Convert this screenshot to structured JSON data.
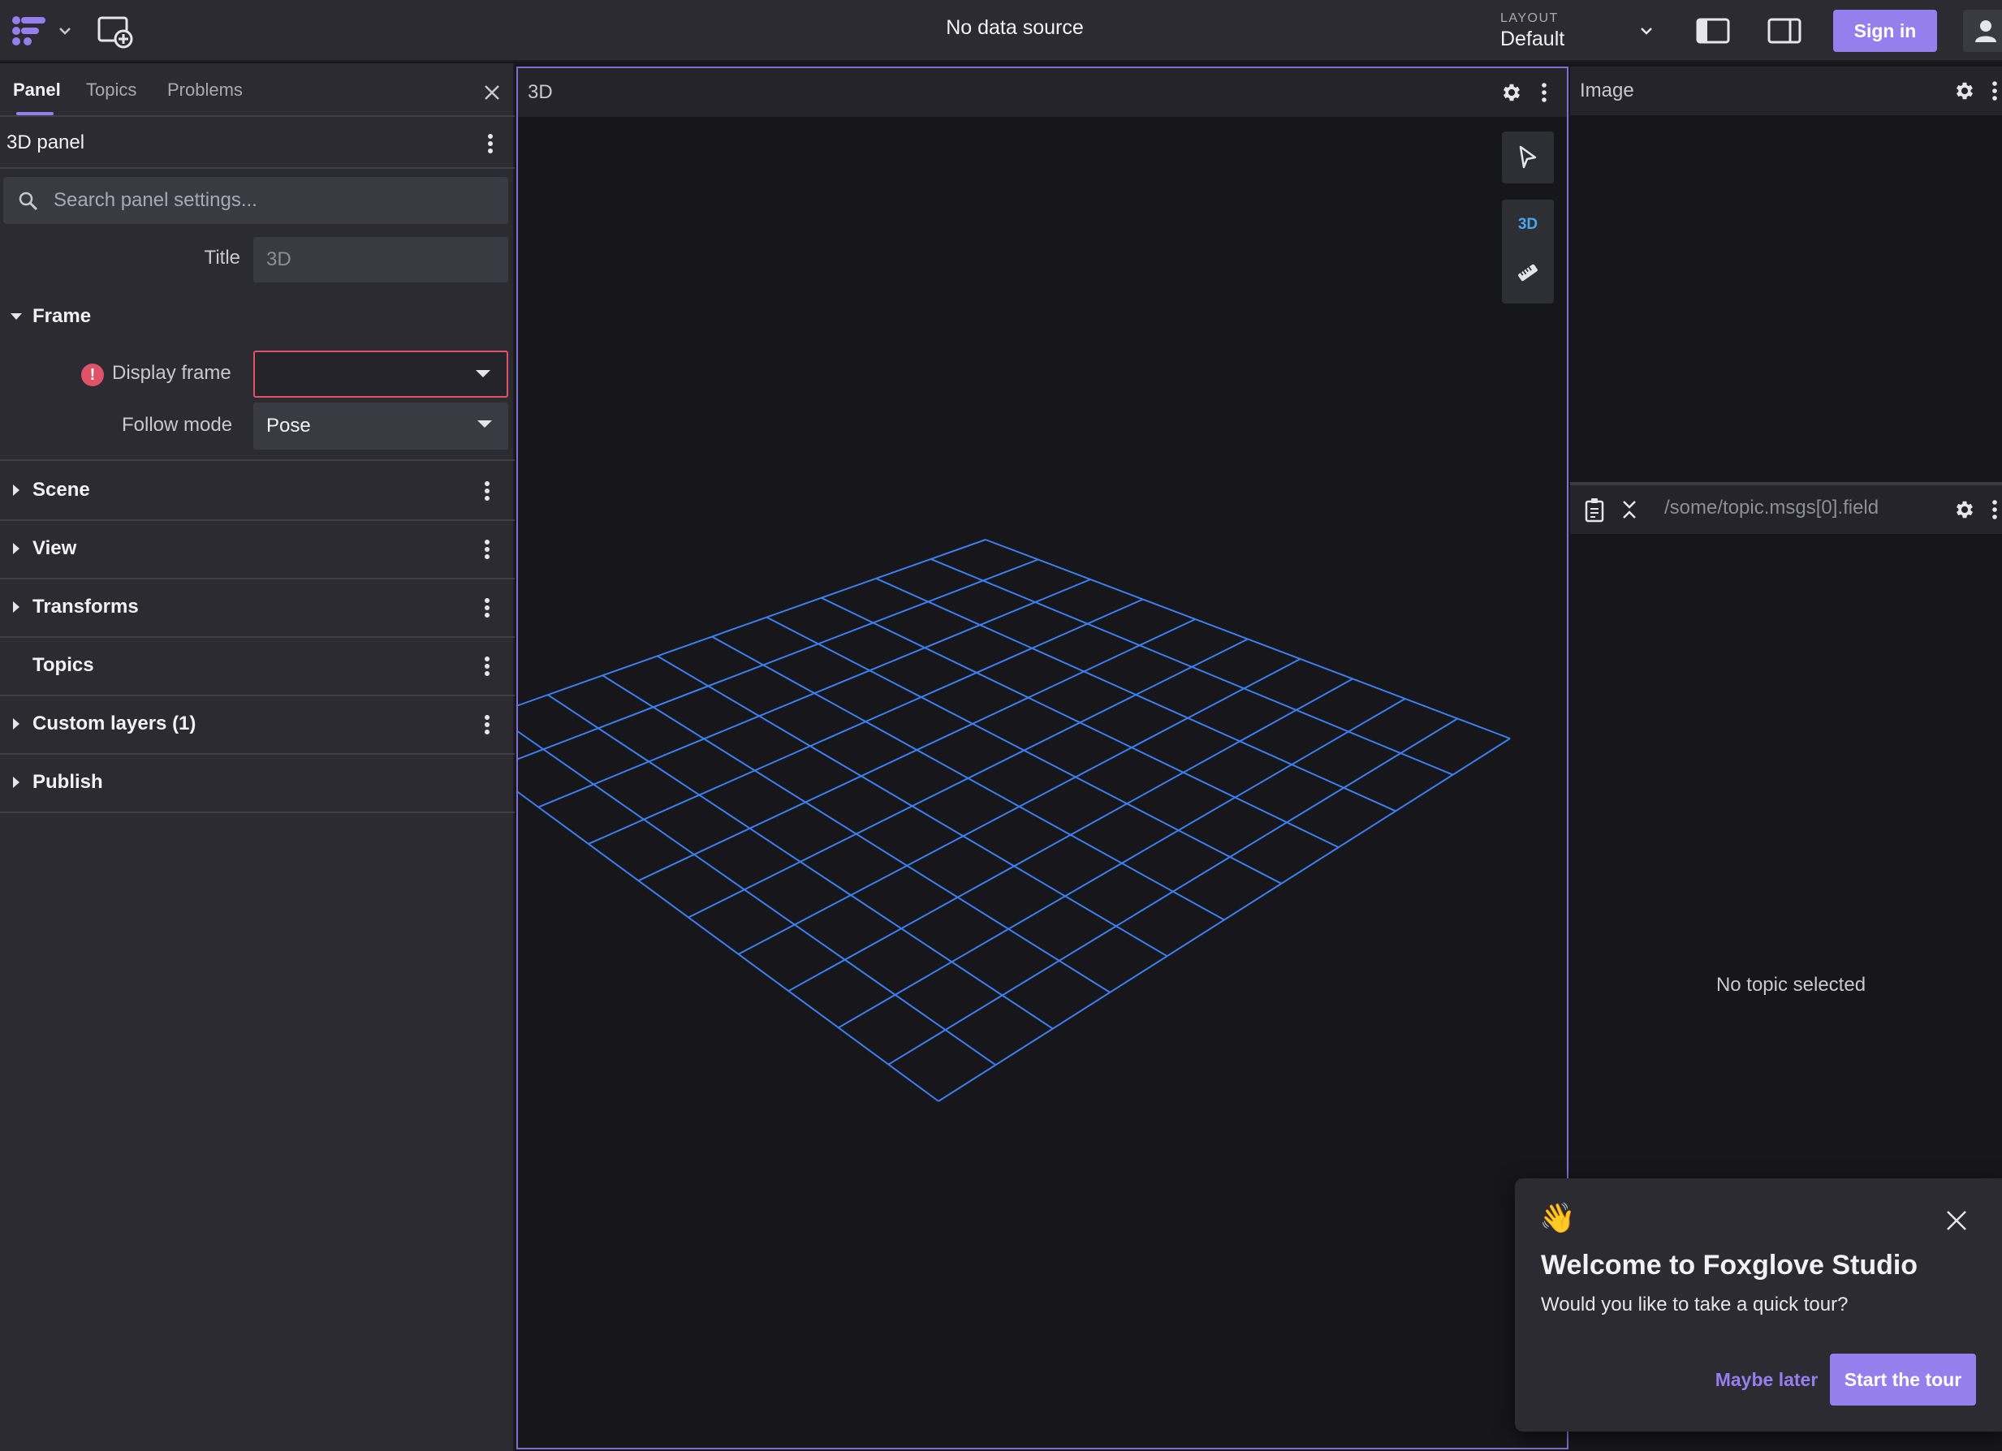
{
  "topbar": {
    "data_source": "No data source",
    "layout_label": "LAYOUT",
    "layout_value": "Default",
    "sign_in": "Sign in"
  },
  "sidebar": {
    "tabs": [
      {
        "label": "Panel",
        "active": true
      },
      {
        "label": "Topics",
        "active": false
      },
      {
        "label": "Problems",
        "active": false
      }
    ],
    "panel_title": "3D panel",
    "search_placeholder": "Search panel settings...",
    "title_field": {
      "label": "Title",
      "placeholder": "3D",
      "value": ""
    },
    "frame_section": {
      "label": "Frame",
      "expanded": true,
      "display_frame": {
        "label": "Display frame",
        "value": "",
        "error": true
      },
      "follow_mode": {
        "label": "Follow mode",
        "value": "Pose"
      }
    },
    "sections": [
      {
        "label": "Scene",
        "expandable": true,
        "menu": true
      },
      {
        "label": "View",
        "expandable": true,
        "menu": true
      },
      {
        "label": "Transforms",
        "expandable": true,
        "menu": true
      },
      {
        "label": "Topics",
        "expandable": false,
        "menu": true
      },
      {
        "label": "Custom layers (1)",
        "expandable": true,
        "menu": true
      },
      {
        "label": "Publish",
        "expandable": true,
        "menu": false
      }
    ]
  },
  "panel3d": {
    "title": "3D",
    "mode_label": "3D",
    "grid_color": "#3b7ff0"
  },
  "image_panel": {
    "title": "Image"
  },
  "raw_panel": {
    "path": "/some/topic.msgs[0].field",
    "empty_text": "No topic selected"
  },
  "toast": {
    "emoji": "👋",
    "title": "Welcome to Foxglove Studio",
    "body": "Would you like to take a quick tour?",
    "later": "Maybe later",
    "start": "Start the tour"
  },
  "colors": {
    "accent": "#9480ed",
    "error": "#e05268",
    "bg_panel": "#16161b",
    "bg_chrome": "#2b2b31"
  }
}
